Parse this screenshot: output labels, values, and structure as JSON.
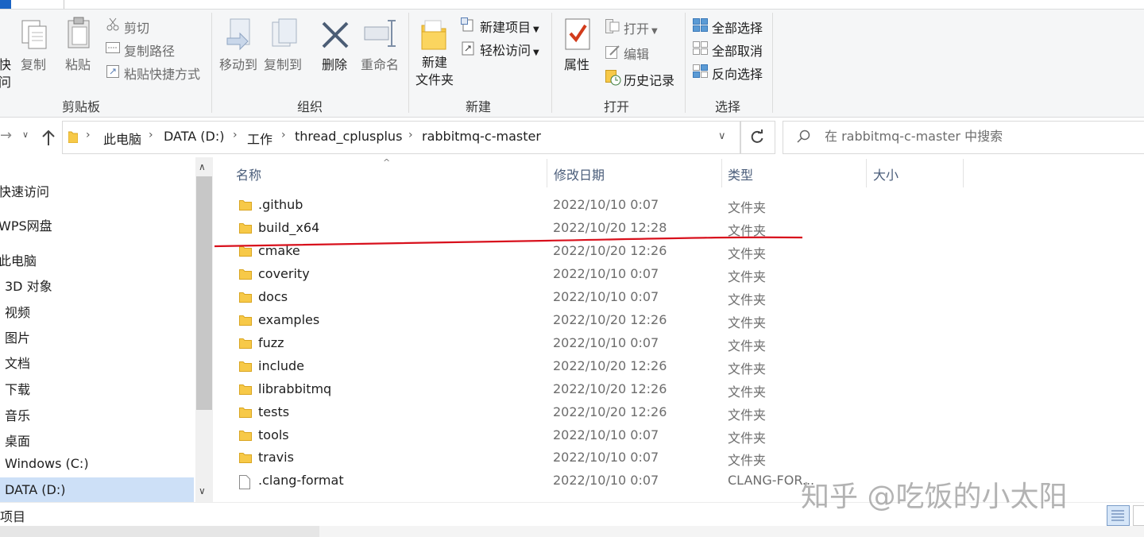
{
  "ribbon": {
    "clipboard": {
      "pin_partial_1": "快",
      "pin_partial_2": "问",
      "copy": "复制",
      "paste": "粘贴",
      "cut": "剪切",
      "copy_path": "复制路径",
      "paste_shortcut": "粘贴快捷方式",
      "group": "剪贴板"
    },
    "organize": {
      "move_to": "移动到",
      "copy_to": "复制到",
      "delete": "删除",
      "rename": "重命名",
      "group": "组织"
    },
    "new": {
      "new_folder_1": "新建",
      "new_folder_2": "文件夹",
      "new_item": "新建项目",
      "easy_access": "轻松访问",
      "group": "新建"
    },
    "open": {
      "properties": "属性",
      "open": "打开",
      "edit": "编辑",
      "history": "历史记录",
      "group": "打开"
    },
    "select": {
      "select_all": "全部选择",
      "select_none": "全部取消",
      "invert": "反向选择",
      "group": "选择"
    }
  },
  "address": {
    "crumbs": [
      "此电脑",
      "DATA (D:)",
      "工作",
      "thread_cplusplus",
      "rabbitmq-c-master"
    ],
    "search_placeholder": "在 rabbitmq-c-master 中搜索"
  },
  "nav": {
    "items": [
      "快速访问",
      "WPS网盘",
      "此电脑",
      "3D 对象",
      "视频",
      "图片",
      "文档",
      "下载",
      "音乐",
      "桌面",
      "Windows (C:)",
      "DATA (D:)"
    ]
  },
  "columns": {
    "name": "名称",
    "date": "修改日期",
    "type": "类型",
    "size": "大小"
  },
  "files": [
    {
      "name": ".github",
      "date": "2022/10/10 0:07",
      "type": "文件夹",
      "kind": "folder"
    },
    {
      "name": "build_x64",
      "date": "2022/10/20 12:28",
      "type": "文件夹",
      "kind": "folder"
    },
    {
      "name": "cmake",
      "date": "2022/10/20 12:26",
      "type": "文件夹",
      "kind": "folder"
    },
    {
      "name": "coverity",
      "date": "2022/10/10 0:07",
      "type": "文件夹",
      "kind": "folder"
    },
    {
      "name": "docs",
      "date": "2022/10/10 0:07",
      "type": "文件夹",
      "kind": "folder"
    },
    {
      "name": "examples",
      "date": "2022/10/20 12:26",
      "type": "文件夹",
      "kind": "folder"
    },
    {
      "name": "fuzz",
      "date": "2022/10/10 0:07",
      "type": "文件夹",
      "kind": "folder"
    },
    {
      "name": "include",
      "date": "2022/10/20 12:26",
      "type": "文件夹",
      "kind": "folder"
    },
    {
      "name": "librabbitmq",
      "date": "2022/10/20 12:26",
      "type": "文件夹",
      "kind": "folder"
    },
    {
      "name": "tests",
      "date": "2022/10/20 12:26",
      "type": "文件夹",
      "kind": "folder"
    },
    {
      "name": "tools",
      "date": "2022/10/10 0:07",
      "type": "文件夹",
      "kind": "folder"
    },
    {
      "name": "travis",
      "date": "2022/10/10 0:07",
      "type": "文件夹",
      "kind": "folder"
    },
    {
      "name": ".clang-format",
      "date": "2022/10/10 0:07",
      "type": "CLANG-FOR...",
      "kind": "file"
    }
  ],
  "status": {
    "items_label": "项目"
  },
  "watermark": "知乎 @吃饭的小太阳",
  "colors": {
    "accent": "#1a64c4",
    "annotation": "#d8101c",
    "folder": "#f7c948",
    "selection": "#cde0f7"
  },
  "icons": {
    "back": "back-arrow-icon",
    "up": "up-arrow-icon",
    "refresh": "refresh-icon",
    "search": "search-icon",
    "folder": "folder-icon"
  }
}
